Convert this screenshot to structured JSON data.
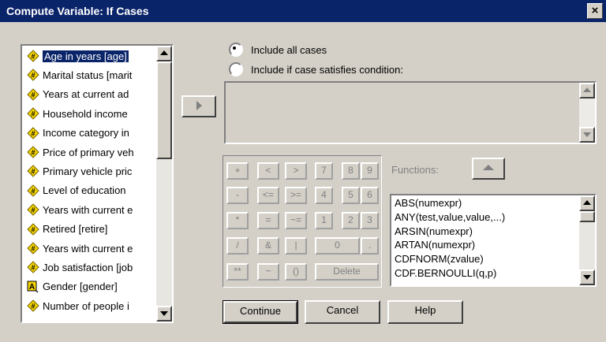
{
  "window": {
    "title": "Compute Variable: If Cases",
    "close_label": "×"
  },
  "variables": [
    {
      "label": "Age in years [age]",
      "icon": "scale-icon",
      "selected": true
    },
    {
      "label": "Marital status [marit",
      "icon": "scale-icon"
    },
    {
      "label": "Years at current ad",
      "icon": "scale-icon"
    },
    {
      "label": "Household income",
      "icon": "scale-icon"
    },
    {
      "label": "Income category in",
      "icon": "scale-icon"
    },
    {
      "label": "Price of primary veh",
      "icon": "scale-icon"
    },
    {
      "label": "Primary vehicle pric",
      "icon": "scale-icon"
    },
    {
      "label": "Level of education",
      "icon": "scale-icon"
    },
    {
      "label": "Years with current e",
      "icon": "scale-icon"
    },
    {
      "label": "Retired [retire]",
      "icon": "scale-icon"
    },
    {
      "label": "Years with current e",
      "icon": "scale-icon"
    },
    {
      "label": "Job satisfaction [job",
      "icon": "scale-icon"
    },
    {
      "label": "Gender [gender]",
      "icon": "string-icon"
    },
    {
      "label": "Number of people i",
      "icon": "scale-icon"
    }
  ],
  "radios": {
    "all": "Include all cases",
    "cond": "Include if case satisfies condition:"
  },
  "keypad": {
    "plus": "+",
    "lt": "<",
    "gt": ">",
    "d7": "7",
    "d8": "8",
    "d9": "9",
    "minus": "-",
    "le": "<=",
    "ge": ">=",
    "d4": "4",
    "d5": "5",
    "d6": "6",
    "mult": "*",
    "eq": "=",
    "ne": "~=",
    "d1": "1",
    "d2": "2",
    "d3": "3",
    "div": "/",
    "and": "&",
    "or": "|",
    "d0": "0",
    "dot": ".",
    "pow": "**",
    "not": "~",
    "paren": "()",
    "delete": "Delete"
  },
  "functions": {
    "label": "Functions:",
    "items": [
      "ABS(numexpr)",
      "ANY(test,value,value,...)",
      "ARSIN(numexpr)",
      "ARTAN(numexpr)",
      "CDFNORM(zvalue)",
      "CDF.BERNOULLI(q,p)"
    ]
  },
  "buttons": {
    "continue": "Continue",
    "cancel": "Cancel",
    "help": "Help"
  }
}
